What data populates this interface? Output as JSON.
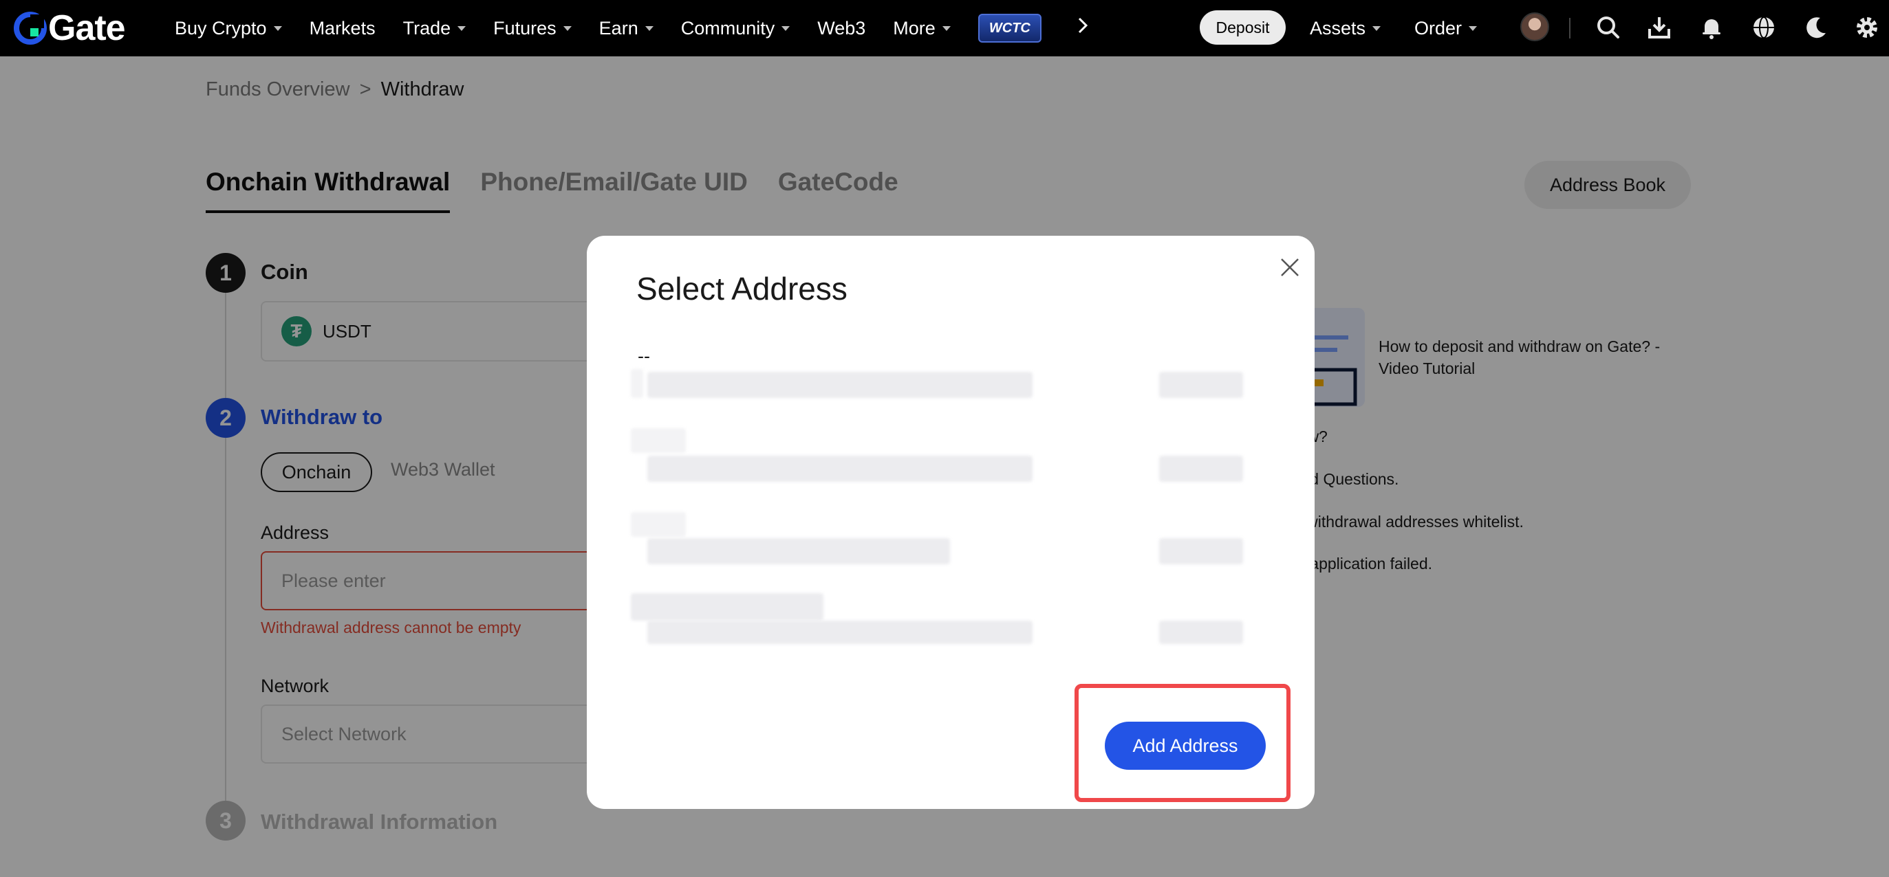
{
  "nav": {
    "logo_text": "Gate",
    "items": [
      {
        "label": "Buy Crypto",
        "caret": true
      },
      {
        "label": "Markets",
        "caret": false
      },
      {
        "label": "Trade",
        "caret": true
      },
      {
        "label": "Futures",
        "caret": true
      },
      {
        "label": "Earn",
        "caret": true
      },
      {
        "label": "Community",
        "caret": true
      },
      {
        "label": "Web3",
        "caret": false
      },
      {
        "label": "More",
        "caret": true
      }
    ],
    "promo_badge": "WCTC",
    "deposit_label": "Deposit",
    "assets_label": "Assets",
    "order_label": "Order",
    "icons": [
      "avatar",
      "search-icon",
      "download-icon",
      "bell-icon",
      "globe-icon",
      "moon-icon",
      "gear-icon"
    ]
  },
  "breadcrumb": {
    "parent": "Funds Overview",
    "separator": ">",
    "current": "Withdraw"
  },
  "tabs": [
    "Onchain Withdrawal",
    "Phone/Email/Gate UID",
    "GateCode"
  ],
  "address_book_label": "Address Book",
  "steps": [
    {
      "number": "1",
      "label": "Coin",
      "color": "#1a1a1a"
    },
    {
      "number": "2",
      "label": "Withdraw to",
      "color": "#2354e6"
    },
    {
      "number": "3",
      "label": "Withdrawal Information",
      "color": "#b8b8b8"
    }
  ],
  "coin": {
    "symbol_glyph": "₮",
    "name": "USDT"
  },
  "withdraw_to": {
    "active": "Onchain",
    "other": "Web3 Wallet"
  },
  "address_field": {
    "label": "Address",
    "placeholder": "Please enter",
    "error": "Withdrawal address cannot be empty"
  },
  "network_field": {
    "label": "Network",
    "placeholder": "Select Network"
  },
  "help": {
    "video_title": "How to deposit and withdraw on Gate? - Video Tutorial",
    "faq_fragments": [
      "raw?",
      "ked Questions.",
      "e withdrawal addresses whitelist.",
      "al application failed."
    ]
  },
  "modal": {
    "title": "Select Address",
    "first_row_label": "--",
    "add_button_label": "Add Address"
  },
  "colors": {
    "accent": "#2354e6",
    "error": "#e54c3c",
    "highlight": "#f0484a",
    "nav_bg": "#000000"
  }
}
